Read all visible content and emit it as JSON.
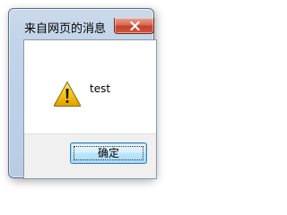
{
  "dialog": {
    "title": "来自网页的消息",
    "close_icon": "close-x-icon",
    "message_icon": "warning-icon",
    "message": "test",
    "ok_label": "确定"
  },
  "colors": {
    "warning_fill": "#f5c518",
    "close_button": "#c4402a",
    "ok_button_border": "#3c7fb1"
  }
}
